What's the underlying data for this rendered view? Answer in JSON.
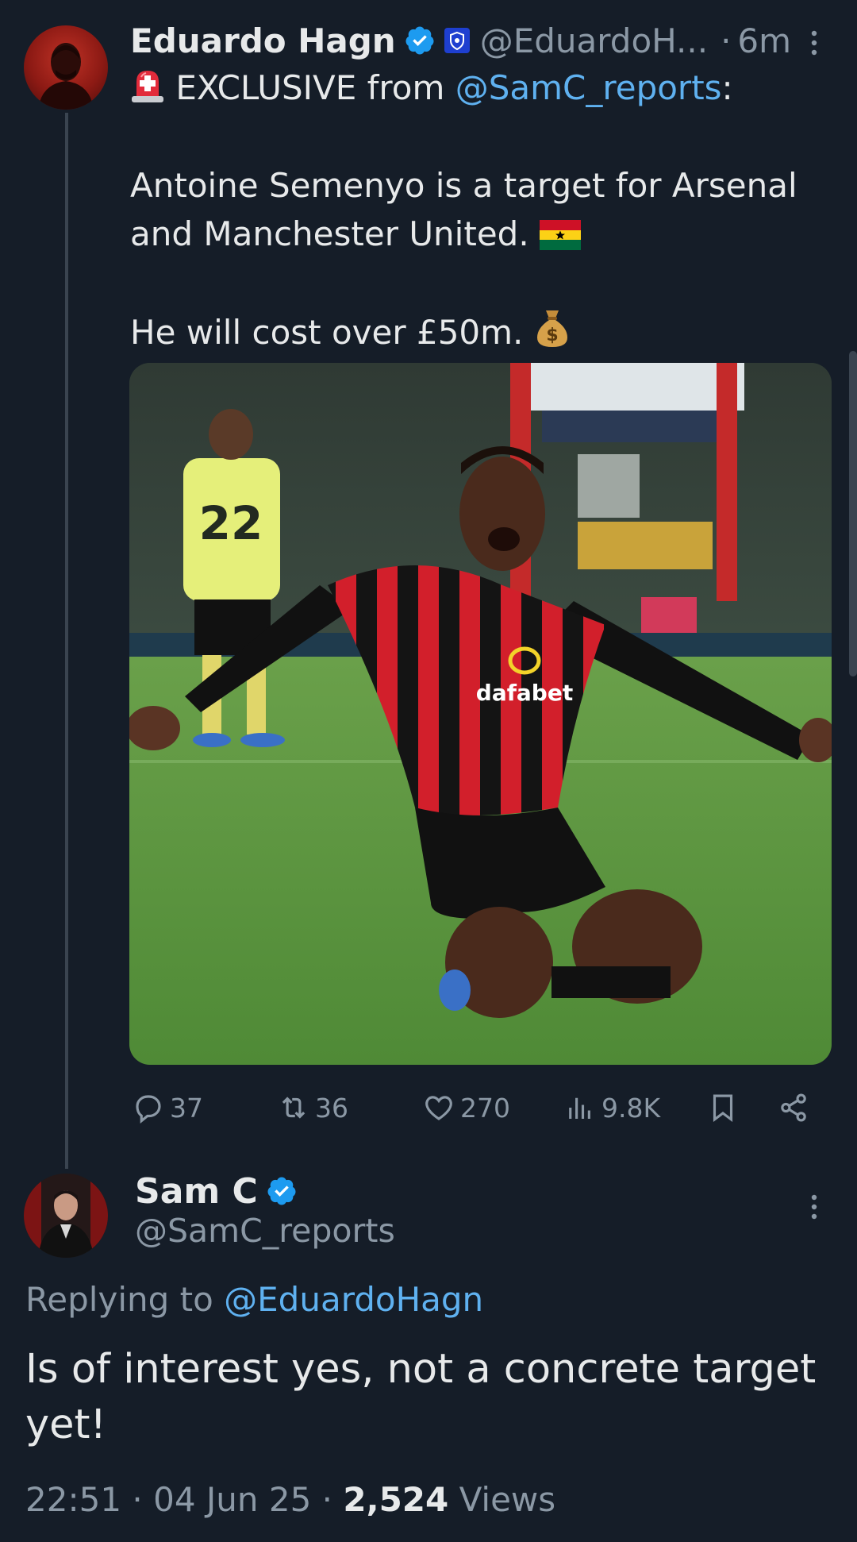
{
  "tweet": {
    "author_name": "Eduardo Hagn",
    "author_handle": "@EduardoH...",
    "separator": "·",
    "time": "6m",
    "line1_prefix": " EXCLUSIVE from ",
    "line1_mention": "@SamC_reports",
    "line1_suffix": ":",
    "line2": "Antoine Semenyo is a target for Arsenal",
    "line3": "and Manchester United. ",
    "line4": "He will cost over £50m. ",
    "media": {
      "player_number": "22",
      "sponsor": "dafabet"
    },
    "actions": {
      "replies": "37",
      "reposts": "36",
      "likes": "270",
      "views": "9.8K"
    }
  },
  "reply": {
    "author_name": "Sam C",
    "author_handle": "@SamC_reports",
    "replying_prefix": "Replying to ",
    "replying_mention": "@EduardoHagn",
    "text": "Is of interest yes, not a concrete target yet!",
    "time": "22:51",
    "separator1": " · ",
    "date": "04 Jun 25",
    "separator2": " · ",
    "views_count": "2,524",
    "views_label": " Views"
  },
  "colors": {
    "background": "#151d28",
    "text_primary": "#e7e9ea",
    "text_secondary": "#8b98a5",
    "link": "#5fb1f0",
    "verified": "#1d9bf0"
  }
}
